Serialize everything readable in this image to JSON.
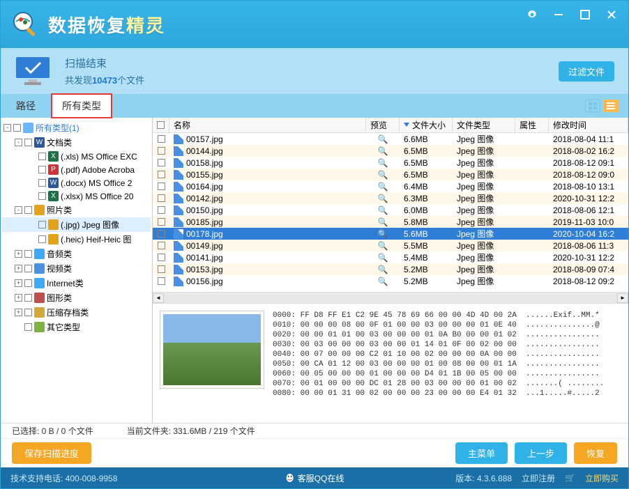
{
  "app": {
    "title_main": "数据恢复",
    "title_accent": "精灵"
  },
  "scan": {
    "status": "扫描结束",
    "found_prefix": "共发现",
    "found_count": "10473",
    "found_suffix": "个文件",
    "filter_btn": "过滤文件"
  },
  "tabs": {
    "path": "路径",
    "all_types": "所有类型"
  },
  "tree": [
    {
      "id": "root",
      "depth": 1,
      "expander": "-",
      "icon": "folder",
      "color": "#6ab7ff",
      "label": "所有类型(1)",
      "labelColor": "#2e7dd6"
    },
    {
      "id": "docs",
      "depth": 2,
      "expander": "-",
      "icon": "W",
      "color": "#2b5797",
      "label": "文档类"
    },
    {
      "id": "xls",
      "depth": 3,
      "expander": "",
      "icon": "X",
      "color": "#1e7145",
      "label": "(.xls) MS Office EXC"
    },
    {
      "id": "pdf",
      "depth": 3,
      "expander": "",
      "icon": "P",
      "color": "#d13438",
      "label": "(.pdf) Adobe Acroba"
    },
    {
      "id": "docx",
      "depth": 3,
      "expander": "",
      "icon": "W",
      "color": "#2b5797",
      "label": "(.docx) MS Office 2"
    },
    {
      "id": "xlsx",
      "depth": 3,
      "expander": "",
      "icon": "X",
      "color": "#1e7145",
      "label": "(.xlsx) MS Office 20"
    },
    {
      "id": "photos",
      "depth": 2,
      "expander": "-",
      "icon": "img",
      "color": "#e3a21a",
      "label": "照片类"
    },
    {
      "id": "jpg",
      "depth": 3,
      "expander": "",
      "icon": "img",
      "color": "#e3a21a",
      "label": "(.jpg) Jpeg 图像",
      "selected": true
    },
    {
      "id": "heic",
      "depth": 3,
      "expander": "",
      "icon": "img",
      "color": "#e3a21a",
      "label": "(.heic) Heif-Heic 图"
    },
    {
      "id": "audio",
      "depth": 2,
      "expander": "+",
      "icon": "aud",
      "color": "#3fa9f5",
      "label": "音频类"
    },
    {
      "id": "video",
      "depth": 2,
      "expander": "+",
      "icon": "vid",
      "color": "#4a90e2",
      "label": "视频类"
    },
    {
      "id": "internet",
      "depth": 2,
      "expander": "+",
      "icon": "net",
      "color": "#3fa9f5",
      "label": "Internet类"
    },
    {
      "id": "graphics",
      "depth": 2,
      "expander": "+",
      "icon": "gfx",
      "color": "#c0504d",
      "label": "图形类"
    },
    {
      "id": "archive",
      "depth": 2,
      "expander": "+",
      "icon": "arc",
      "color": "#d1a93a",
      "label": "压缩存档类"
    },
    {
      "id": "other",
      "depth": 2,
      "expander": "",
      "icon": "oth",
      "color": "#7cb342",
      "label": "其它类型"
    }
  ],
  "columns": {
    "name": "名称",
    "preview": "预览",
    "size": "文件大小",
    "type": "文件类型",
    "attr": "属性",
    "date": "修改时间"
  },
  "files": [
    {
      "name": "00157.jpg",
      "size": "6.6MB",
      "type": "Jpeg 图像",
      "date": "2018-08-04 11:1"
    },
    {
      "name": "00144.jpg",
      "size": "6.5MB",
      "type": "Jpeg 图像",
      "date": "2018-08-02 16:2"
    },
    {
      "name": "00158.jpg",
      "size": "6.5MB",
      "type": "Jpeg 图像",
      "date": "2018-08-12 09:1"
    },
    {
      "name": "00155.jpg",
      "size": "6.5MB",
      "type": "Jpeg 图像",
      "date": "2018-08-12 09:0"
    },
    {
      "name": "00164.jpg",
      "size": "6.4MB",
      "type": "Jpeg 图像",
      "date": "2018-08-10 13:1"
    },
    {
      "name": "00142.jpg",
      "size": "6.3MB",
      "type": "Jpeg 图像",
      "date": "2020-10-31 12:2"
    },
    {
      "name": "00150.jpg",
      "size": "6.0MB",
      "type": "Jpeg 图像",
      "date": "2018-08-06 12:1"
    },
    {
      "name": "00185.jpg",
      "size": "5.8MB",
      "type": "Jpeg 图像",
      "date": "2019-11-03 10:0"
    },
    {
      "name": "00178.jpg",
      "size": "5.6MB",
      "type": "Jpeg 图像",
      "date": "2020-10-04 16:2",
      "selected": true
    },
    {
      "name": "00149.jpg",
      "size": "5.5MB",
      "type": "Jpeg 图像",
      "date": "2018-08-06 11:3"
    },
    {
      "name": "00141.jpg",
      "size": "5.4MB",
      "type": "Jpeg 图像",
      "date": "2020-10-31 12:2"
    },
    {
      "name": "00153.jpg",
      "size": "5.2MB",
      "type": "Jpeg 图像",
      "date": "2018-08-09 07:4"
    },
    {
      "name": "00156.jpg",
      "size": "5.2MB",
      "type": "Jpeg 图像",
      "date": "2018-08-12 09:2"
    }
  ],
  "hex": "0000: FF D8 FF E1 C2 9E 45 78 69 66 00 00 4D 4D 00 2A  ......Exif..MM.*\n0010: 00 00 00 08 00 0F 01 00 00 03 00 00 00 01 0E 40  ...............@\n0020: 00 00 01 01 00 03 00 00 00 01 0A B0 00 00 01 02  ................\n0030: 00 03 00 00 00 03 00 00 01 14 01 0F 00 02 00 00  ................\n0040: 00 07 00 00 00 C2 01 10 00 02 00 00 00 0A 00 00  ................\n0050: 00 CA 01 12 00 03 00 00 00 01 00 08 00 00 01 1A  ................\n0060: 00 05 00 00 00 01 00 00 00 D4 01 1B 00 05 00 00  ................\n0070: 00 01 00 00 00 DC 01 28 00 03 00 00 00 01 00 02  .......( ........\n0080: 00 00 01 31 00 02 00 00 00 23 00 00 00 E4 01 32  ...1.....#.....2",
  "status": {
    "selected": "已选择: 0 B / 0 个文件",
    "folder": "当前文件夹:  331.6MB / 219 个文件"
  },
  "actions": {
    "save": "保存扫描进度",
    "menu": "主菜单",
    "prev": "上一步",
    "recover": "恢复"
  },
  "footer": {
    "support": "技术支持电话:  400-008-9958",
    "qq": "客服QQ在线",
    "version_label": "版本:",
    "version": "4.3.6.888",
    "register": "立即注册",
    "buy": "立即购买"
  }
}
